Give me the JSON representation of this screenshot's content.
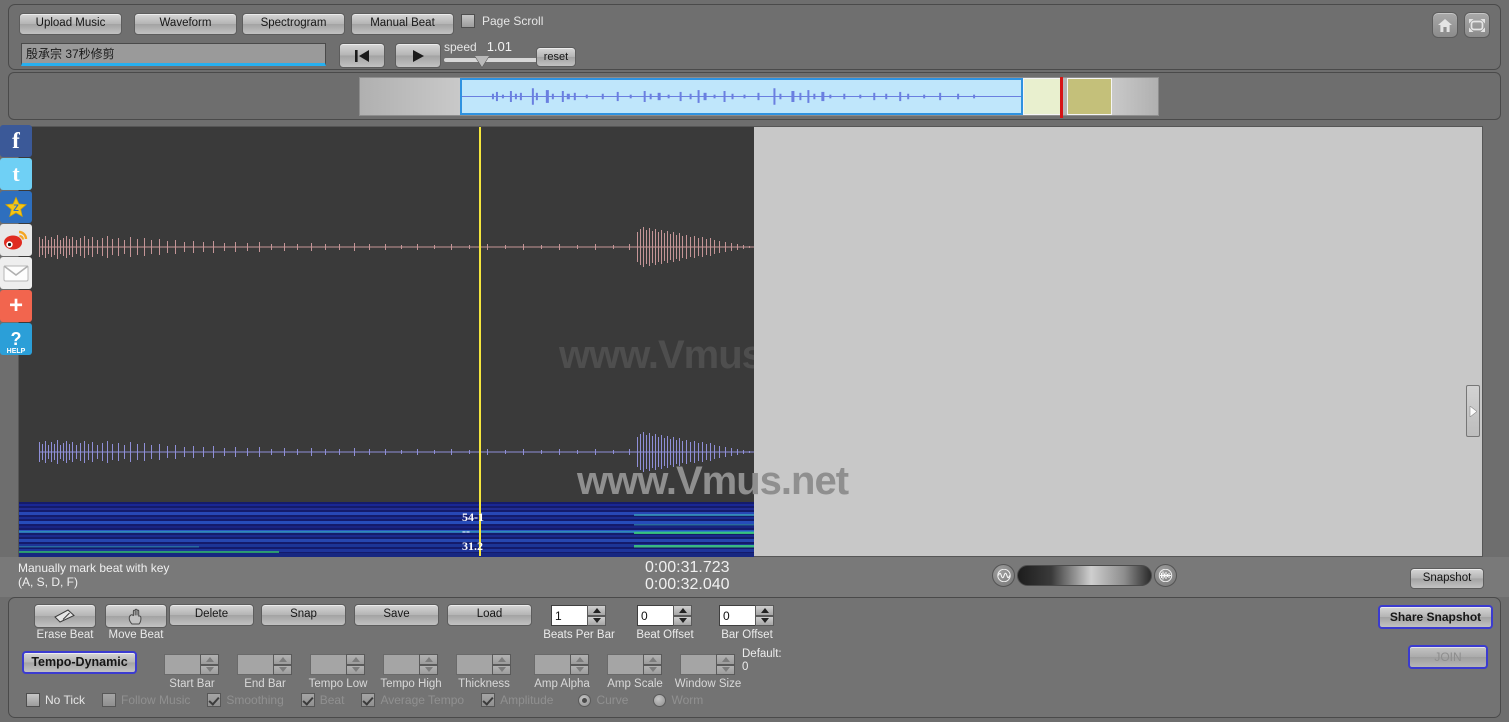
{
  "app": {
    "watermark": "www.Vmus.net"
  },
  "toolbar": {
    "upload_label": "Upload Music",
    "waveform_label": "Waveform",
    "spectrogram_label": "Spectrogram",
    "manual_beat_label": "Manual Beat",
    "page_scroll_label": "Page Scroll",
    "page_scroll_checked": false,
    "home_icon": "home-icon",
    "fullscreen_icon": "fullscreen-icon"
  },
  "track": {
    "title_value": "殷承宗 37秒修剪",
    "title_placeholder": ""
  },
  "transport": {
    "rewind_icon": "skip-to-start-icon",
    "play_icon": "play-icon",
    "speed_label": "speed",
    "speed_value": "1.01",
    "reset_label": "reset"
  },
  "stage": {
    "spectro_labels": [
      "54-1",
      "--",
      "31.2"
    ],
    "collapse_handle_icon": "chevron-right-icon"
  },
  "social": [
    {
      "name": "facebook-share-icon",
      "glyph": "f"
    },
    {
      "name": "twitter-share-icon",
      "glyph": "t"
    },
    {
      "name": "star-share-icon",
      "glyph": "★"
    },
    {
      "name": "weibo-share-icon",
      "glyph": "◉"
    },
    {
      "name": "email-share-icon",
      "glyph": "✉"
    },
    {
      "name": "more-share-icon",
      "glyph": "+"
    },
    {
      "name": "help-icon",
      "glyph": "?",
      "caption": "HELP"
    }
  ],
  "status": {
    "hint_line1": "Manually mark beat with key",
    "hint_line2": "(A, S, D, F)",
    "time_current": "0:00:31.723",
    "time_total": "0:00:32.040",
    "snapshot_label": "Snapshot",
    "morph_left_icon": "sine-wave-icon",
    "morph_right_icon": "audio-waveform-icon"
  },
  "beat_tools": {
    "erase_beat_label": "Erase Beat",
    "erase_beat_icon": "eraser-icon",
    "move_beat_label": "Move Beat",
    "move_beat_icon": "hand-drag-icon",
    "delete_label": "Delete",
    "snap_label": "Snap",
    "save_label": "Save",
    "load_label": "Load",
    "spinners": [
      {
        "caption": "Beats Per Bar",
        "value": "1",
        "enabled": true
      },
      {
        "caption": "Beat Offset",
        "value": "0",
        "enabled": true
      },
      {
        "caption": "Bar Offset",
        "value": "0",
        "enabled": true
      }
    ]
  },
  "tempo_tools": {
    "mode_label": "Tempo-Dynamic",
    "spinners": [
      {
        "caption": "Start Bar",
        "value": "",
        "enabled": false
      },
      {
        "caption": "End Bar",
        "value": "",
        "enabled": false
      },
      {
        "caption": "Tempo Low",
        "value": "",
        "enabled": false
      },
      {
        "caption": "Tempo High",
        "value": "",
        "enabled": false
      },
      {
        "caption": "Thickness",
        "value": "",
        "enabled": false
      },
      {
        "caption": "Amp Alpha",
        "value": "",
        "enabled": false
      },
      {
        "caption": "Amp Scale",
        "value": "",
        "enabled": false
      },
      {
        "caption": "Window Size",
        "value": "",
        "enabled": false
      }
    ],
    "default_label": "Default:",
    "default_value": "0"
  },
  "options": [
    {
      "type": "checkbox",
      "label": "No Tick",
      "checked": false,
      "enabled": true
    },
    {
      "type": "checkbox",
      "label": "Follow Music",
      "checked": false,
      "enabled": false
    },
    {
      "type": "checkbox",
      "label": "Smoothing",
      "checked": true,
      "enabled": false
    },
    {
      "type": "checkbox",
      "label": "Beat",
      "checked": true,
      "enabled": false
    },
    {
      "type": "checkbox",
      "label": "Average Tempo",
      "checked": true,
      "enabled": false
    },
    {
      "type": "checkbox",
      "label": "Amplitude",
      "checked": true,
      "enabled": false
    },
    {
      "type": "radio",
      "label": "Curve",
      "checked": true,
      "enabled": false
    },
    {
      "type": "radio",
      "label": "Worm",
      "checked": false,
      "enabled": false
    }
  ],
  "share": {
    "share_snapshot_label": "Share Snapshot",
    "join_label": "JOIN"
  },
  "colors": {
    "panel_bg": "#737373",
    "stage_light": "#c8c8c8",
    "stage_dark": "#3a3a3a",
    "playhead": "#f5e63c",
    "selection_fill": "#bfe6fb",
    "selection_border": "#2f92e0",
    "overview_marker": "#d61414",
    "accent_focus": "#3b3bd0",
    "title_underline": "#27b0f0"
  }
}
